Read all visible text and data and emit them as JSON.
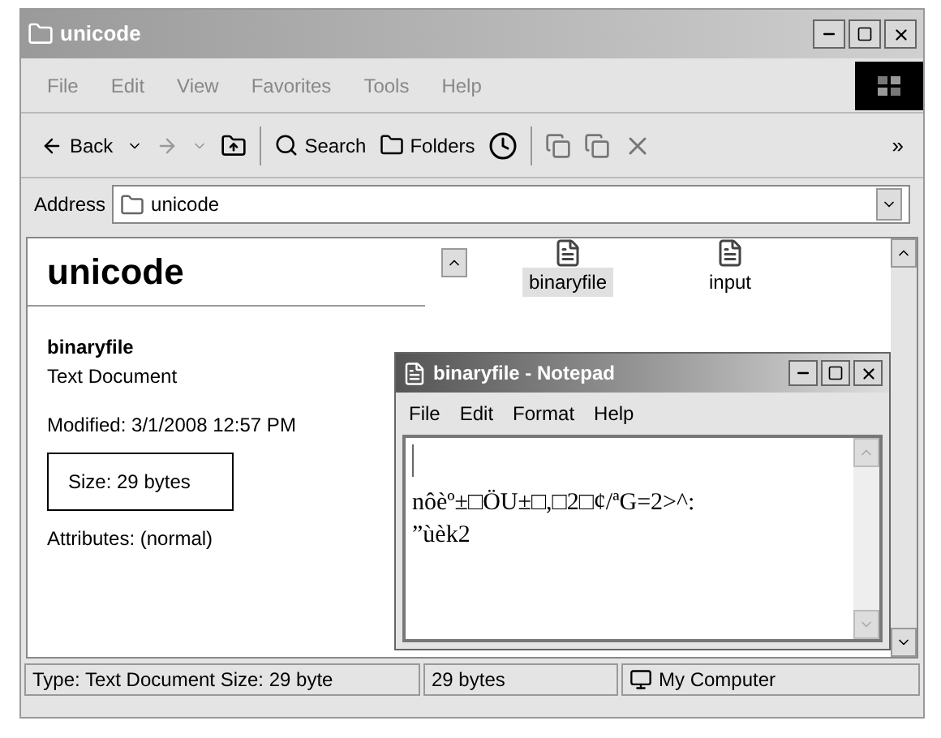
{
  "window": {
    "title": "unicode"
  },
  "menu": [
    "File",
    "Edit",
    "View",
    "Favorites",
    "Tools",
    "Help"
  ],
  "toolbar": {
    "back": "Back",
    "search": "Search",
    "folders": "Folders",
    "more": "»"
  },
  "address": {
    "label": "Address",
    "value": "unicode"
  },
  "details": {
    "heading": "unicode",
    "name": "binaryfile",
    "type": "Text Document",
    "modified": "Modified: 3/1/2008 12:57 PM",
    "size": "Size: 29 bytes",
    "attributes": "Attributes: (normal)"
  },
  "files": [
    {
      "name": "binaryfile",
      "selected": true
    },
    {
      "name": "input",
      "selected": false
    }
  ],
  "notepad": {
    "title": "binaryfile - Notepad",
    "menu": [
      "File",
      "Edit",
      "Format",
      "Help"
    ],
    "lines": [
      "nôèº±□ÖU±□,□2□¢/ªG=2>^:",
      "”ùèk2"
    ]
  },
  "status_bar": [
    "Type: Text Document Size: 29 byte",
    "29 bytes",
    "My Computer"
  ]
}
